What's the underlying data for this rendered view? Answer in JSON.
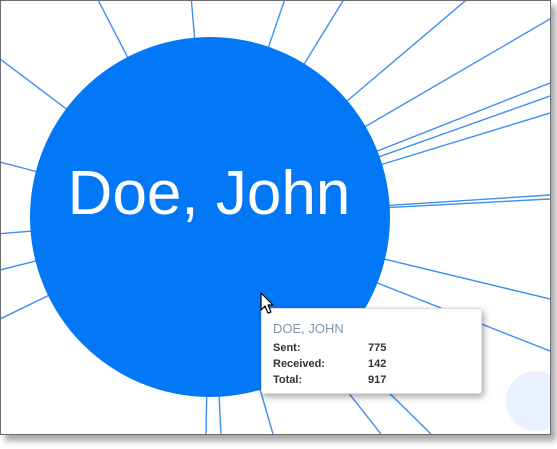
{
  "node": {
    "name": "Doe, John",
    "color": "#0378f6"
  },
  "edge_color": "#3d8ff1",
  "tooltip": {
    "title": "DOE, JOHN",
    "rows": [
      {
        "label": "Sent:",
        "value": "775"
      },
      {
        "label": "Received:",
        "value": "142"
      },
      {
        "label": "Total:",
        "value": "917"
      }
    ]
  },
  "cursor": "arrow-pointer-icon"
}
